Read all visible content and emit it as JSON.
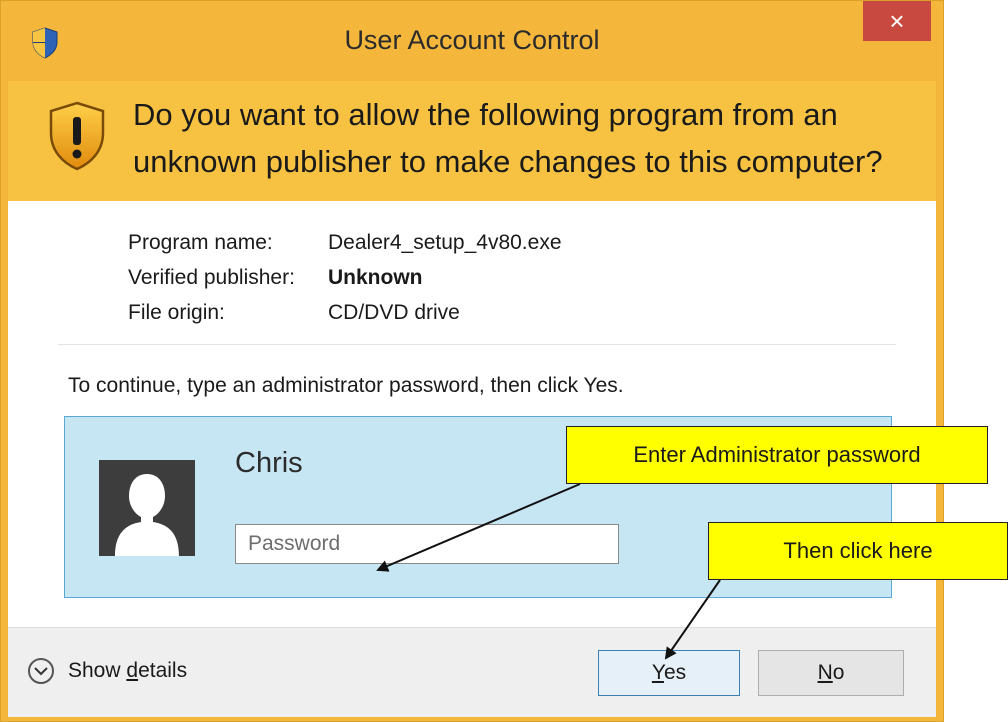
{
  "window": {
    "title": "User Account Control",
    "close_glyph": "×",
    "accent_color": "#f7c242",
    "close_color": "#c7493f"
  },
  "header": {
    "question": "Do you want to allow the following program from an unknown publisher to make changes to this computer?"
  },
  "program_info": {
    "name_label": "Program name:",
    "name_value": "Dealer4_setup_4v80.exe",
    "publisher_label": "Verified publisher:",
    "publisher_value": "Unknown",
    "origin_label": "File origin:",
    "origin_value": "CD/DVD drive"
  },
  "credentials": {
    "instruction": "To continue, type an administrator password, then click Yes.",
    "user_name": "Chris",
    "password_placeholder": "Password",
    "password_value": ""
  },
  "footer": {
    "details_prefix": "Show ",
    "details_underlined": "d",
    "details_suffix": "etails",
    "yes_underlined": "Y",
    "yes_rest": "es",
    "no_underlined": "N",
    "no_rest": "o"
  },
  "callouts": {
    "password_hint": "Enter Administrator password",
    "click_hint": "Then click here",
    "color": "#ffff00"
  },
  "icons": [
    "uac-shield-icon",
    "warning-shield-icon",
    "close-icon",
    "user-avatar-icon",
    "chevron-down-icon"
  ]
}
